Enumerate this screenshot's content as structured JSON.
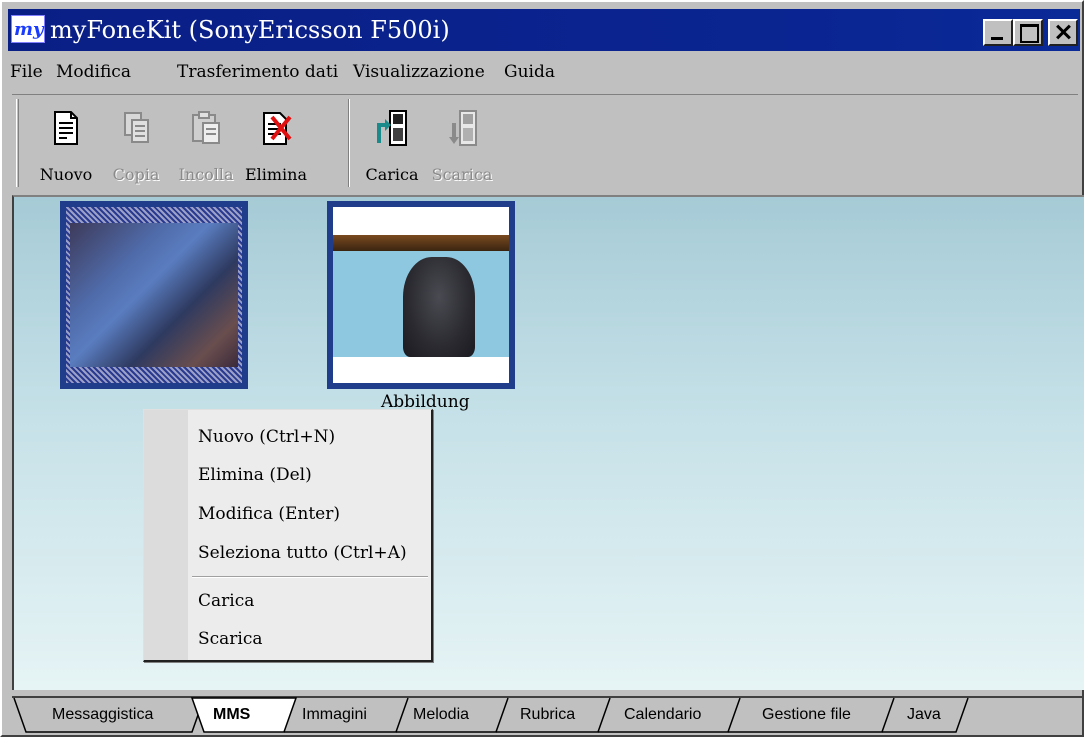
{
  "window": {
    "title": "myFoneKit (SonyEricsson F500i)",
    "icon_text": "my"
  },
  "menu": [
    "File",
    "Modifica",
    "Trasferimento dati",
    "Visualizzazione",
    "Guida"
  ],
  "toolbar": {
    "new_label": "Nuovo",
    "copy_label": "Copia",
    "paste_label": "Incolla",
    "delete_label": "Elimina",
    "upload_label": "Carica",
    "download_label": "Scarica"
  },
  "items": [
    {
      "label": "",
      "selected": true
    },
    {
      "label": "Abbildung",
      "selected": false
    }
  ],
  "context_menu": {
    "new": "Nuovo (Ctrl+N)",
    "delete": "Elimina (Del)",
    "edit": "Modifica (Enter)",
    "select_all": "Seleziona tutto (Ctrl+A)",
    "upload": "Carica",
    "download": "Scarica"
  },
  "tabs": {
    "messaging": "Messaggistica",
    "mms": "MMS",
    "images": "Immagini",
    "melody": "Melodia",
    "contacts": "Rubrica",
    "calendar": "Calendario",
    "files": "Gestione file",
    "java": "Java",
    "active": "MMS"
  },
  "colors": {
    "titlebar": "#0a1f86",
    "selection": "#1f3d8a"
  }
}
